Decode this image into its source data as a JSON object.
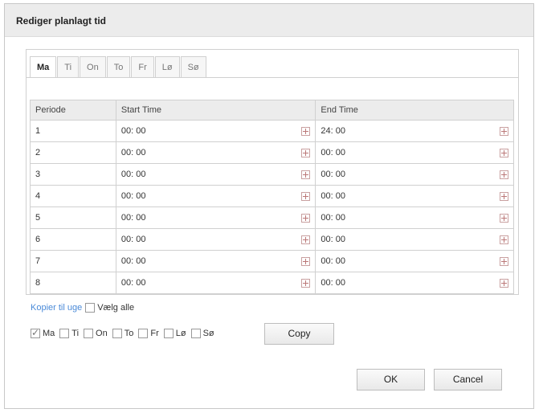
{
  "dialog": {
    "title": "Rediger planlagt tid"
  },
  "tabs": [
    {
      "label": "Ma",
      "active": true
    },
    {
      "label": "Ti"
    },
    {
      "label": "On"
    },
    {
      "label": "To"
    },
    {
      "label": "Fr"
    },
    {
      "label": "Lø"
    },
    {
      "label": "Sø"
    }
  ],
  "table": {
    "headers": [
      "Periode",
      "Start Time",
      "End Time"
    ],
    "rows": [
      {
        "period": "1",
        "start": "00: 00",
        "end": "24: 00"
      },
      {
        "period": "2",
        "start": "00: 00",
        "end": "00: 00"
      },
      {
        "period": "3",
        "start": "00: 00",
        "end": "00: 00"
      },
      {
        "period": "4",
        "start": "00: 00",
        "end": "00: 00"
      },
      {
        "period": "5",
        "start": "00: 00",
        "end": "00: 00"
      },
      {
        "period": "6",
        "start": "00: 00",
        "end": "00: 00"
      },
      {
        "period": "7",
        "start": "00: 00",
        "end": "00: 00"
      },
      {
        "period": "8",
        "start": "00: 00",
        "end": "00: 00"
      }
    ]
  },
  "copy": {
    "link": "Kopier til uge",
    "select_all": "Vælg alle",
    "days": [
      {
        "label": "Ma",
        "checked": true
      },
      {
        "label": "Ti",
        "checked": false
      },
      {
        "label": "On",
        "checked": false
      },
      {
        "label": "To",
        "checked": false
      },
      {
        "label": "Fr",
        "checked": false
      },
      {
        "label": "Lø",
        "checked": false
      },
      {
        "label": "Sø",
        "checked": false
      }
    ],
    "copy_button": "Copy"
  },
  "buttons": {
    "ok": "OK",
    "cancel": "Cancel"
  },
  "icons": {
    "time_picker": "clock-icon"
  }
}
